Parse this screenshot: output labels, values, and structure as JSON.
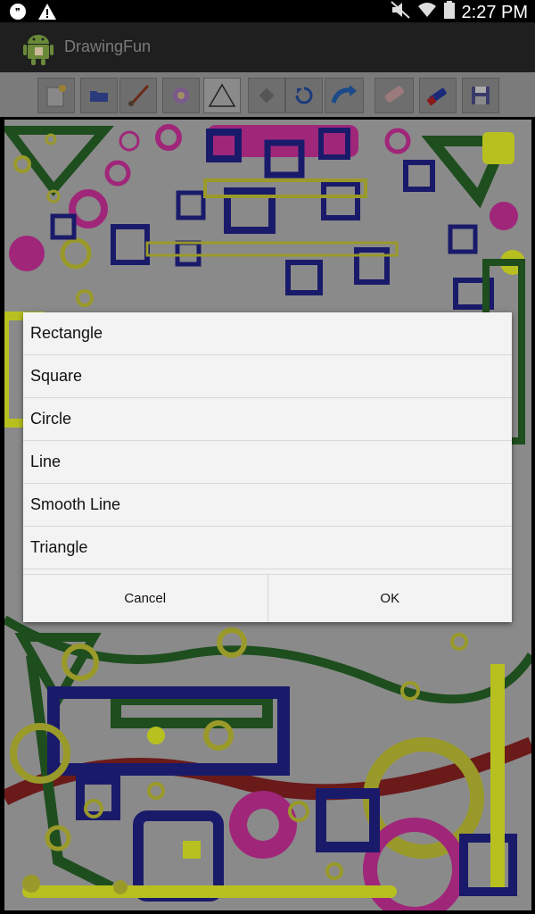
{
  "status_bar": {
    "time": "2:27 PM",
    "icons": [
      "chat-bubble-icon",
      "warning-icon",
      "mute-icon",
      "wifi-icon",
      "battery-icon"
    ]
  },
  "app": {
    "title": "DrawingFun",
    "icon": "android-icon"
  },
  "toolbar": {
    "tools": [
      {
        "name": "new-canvas-icon"
      },
      {
        "name": "open-file-icon"
      },
      {
        "name": "brush-icon"
      },
      {
        "name": "color-palette-icon"
      },
      {
        "name": "shape-triangle-icon"
      },
      {
        "name": "fill-icon"
      },
      {
        "name": "undo-icon"
      },
      {
        "name": "redo-icon"
      },
      {
        "name": "eraser-icon"
      },
      {
        "name": "clear-icon"
      },
      {
        "name": "save-icon"
      }
    ]
  },
  "dialog": {
    "options": [
      "Rectangle",
      "Square",
      "Circle",
      "Line",
      "Smooth Line",
      "Triangle"
    ],
    "cancel_label": "Cancel",
    "ok_label": "OK"
  },
  "colors": {
    "navy": "#1a1a6b",
    "magenta": "#a0267a",
    "olive": "#9a9a2a",
    "dark_green": "#1e4d1e",
    "yellow_green": "#b8c020",
    "maroon": "#6b1a1a"
  }
}
